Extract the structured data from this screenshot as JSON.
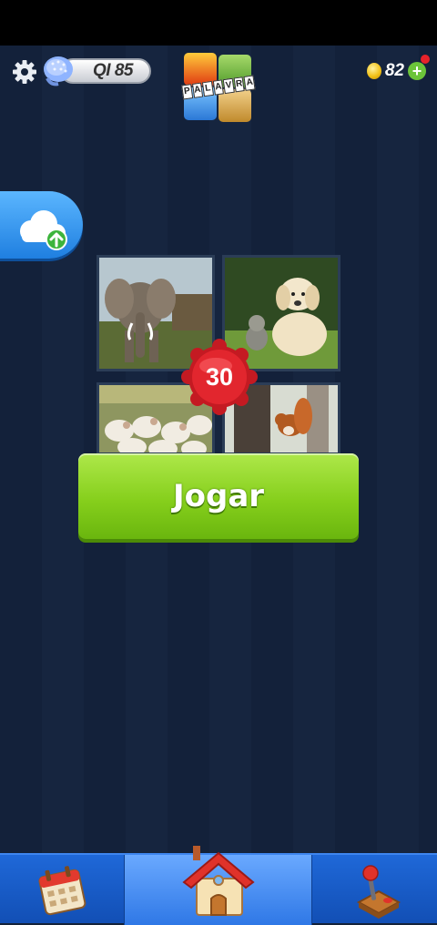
{
  "header": {
    "settings_icon": "gear-icon",
    "level_icon": "brain-icon",
    "level_label": "QI 85",
    "logo_letters": [
      "P",
      "A",
      "L",
      "A",
      "V",
      "R",
      "A"
    ],
    "coins_icon": "coin-icon",
    "coins_count": "82",
    "add_coins_icon": "plus-icon"
  },
  "cloud_button": {
    "icon": "cloud-upload-icon"
  },
  "puzzle": {
    "level_number": "30",
    "images": [
      "elephant",
      "puppy-and-kitten",
      "sheep",
      "squirrel-on-tree"
    ]
  },
  "play_button": {
    "label": "Jogar"
  },
  "bottom_nav": {
    "items": [
      {
        "icon": "calendar-icon",
        "selected": false
      },
      {
        "icon": "home-icon",
        "selected": true
      },
      {
        "icon": "joystick-icon",
        "selected": false
      }
    ]
  },
  "colors": {
    "background": "#142239",
    "play_green": "#86cf1c",
    "nav_blue": "#1f68d8",
    "badge_red": "#d9202a"
  }
}
